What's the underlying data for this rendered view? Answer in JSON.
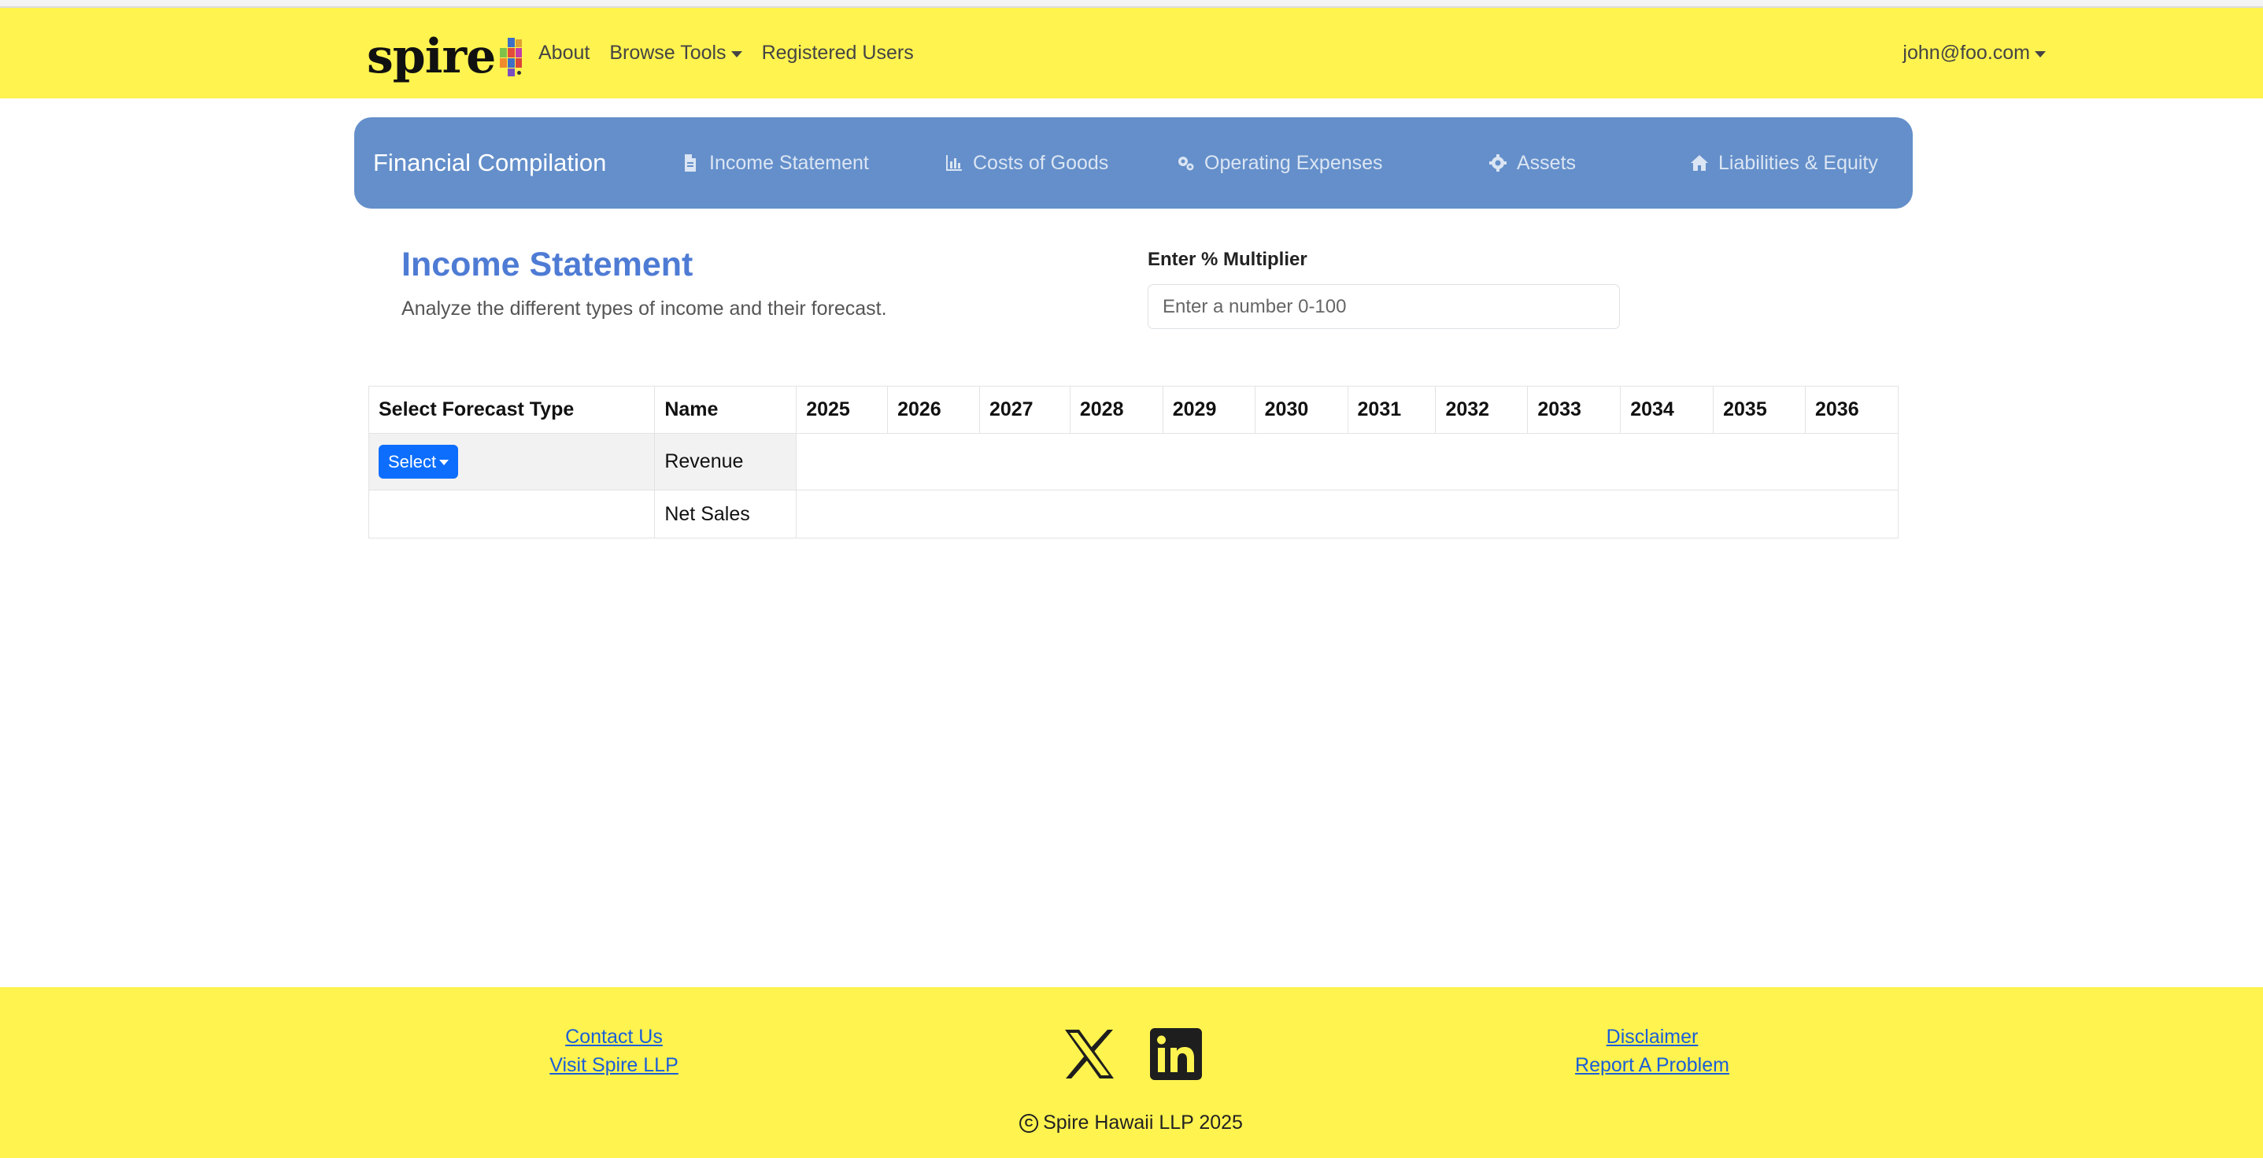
{
  "navbar": {
    "brand": "spire",
    "links": {
      "about": "About",
      "browse_tools": "Browse Tools",
      "registered_users": "Registered Users"
    },
    "user": "john@foo.com"
  },
  "subnav": {
    "title": "Financial Compilation",
    "items": [
      {
        "label": "Income Statement",
        "icon": "file-icon"
      },
      {
        "label": "Costs of Goods",
        "icon": "bar-chart-icon"
      },
      {
        "label": "Operating Expenses",
        "icon": "gears-icon"
      },
      {
        "label": "Assets",
        "icon": "gear-icon"
      },
      {
        "label": "Liabilities & Equity",
        "icon": "home-icon"
      }
    ]
  },
  "page": {
    "title": "Income Statement",
    "subtitle": "Analyze the different types of income and their forecast."
  },
  "multiplier": {
    "label": "Enter % Multiplier",
    "placeholder": "Enter a number 0-100",
    "value": ""
  },
  "table": {
    "headers": {
      "forecast_type": "Select Forecast Type",
      "name": "Name",
      "years": [
        "2025",
        "2026",
        "2027",
        "2028",
        "2029",
        "2030",
        "2031",
        "2032",
        "2033",
        "2034",
        "2035",
        "2036"
      ]
    },
    "rows": [
      {
        "name": "Revenue",
        "select_label": "Select"
      },
      {
        "name": "Net Sales"
      }
    ]
  },
  "footer": {
    "contact_us": "Contact Us",
    "visit_spire": "Visit Spire LLP",
    "disclaimer": "Disclaimer",
    "report_problem": "Report A Problem",
    "copyright": "Spire Hawaii LLP 2025",
    "social": [
      "x-logo-icon",
      "linkedin-icon"
    ]
  },
  "colors": {
    "navbar_bg": "#fff34f",
    "subnav_bg": "#648fca",
    "title_blue": "#4e7bd4",
    "button_blue": "#0d6efd",
    "link_blue": "#1a5fd8"
  }
}
